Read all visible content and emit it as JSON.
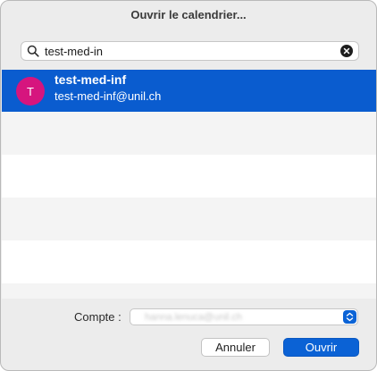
{
  "dialog": {
    "title": "Ouvrir le calendrier..."
  },
  "search": {
    "value": "test-med-in"
  },
  "results": [
    {
      "initial": "T",
      "name": "test-med-inf",
      "email": "test-med-inf@unil.ch",
      "selected": true,
      "avatar_color": "#d6157e"
    }
  ],
  "account": {
    "label": "Compte :",
    "value": "hanna.lenuca@unil.ch"
  },
  "buttons": {
    "cancel_label": "Annuler",
    "open_label": "Ouvrir"
  },
  "colors": {
    "accent": "#0b62d5",
    "selection": "#0a5ccf"
  }
}
